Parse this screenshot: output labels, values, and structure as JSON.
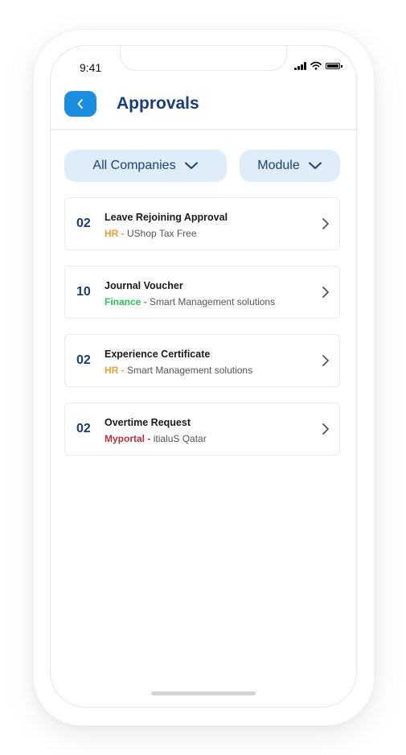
{
  "status": {
    "time": "9:41"
  },
  "header": {
    "title": "Approvals"
  },
  "filters": {
    "companies_label": "All Companies",
    "module_label": "Module"
  },
  "items": [
    {
      "count": "02",
      "title": "Leave Rejoining Approval",
      "module": "HR",
      "module_color": "#f0a030",
      "separator": " - ",
      "company": "UShop Tax Free"
    },
    {
      "count": "10",
      "title": "Journal Voucher",
      "module": "Finance",
      "module_color": "#2fbf5f",
      "separator": " - ",
      "company": "Smart Management solutions"
    },
    {
      "count": "02",
      "title": "Experience Certificate",
      "module": "HR",
      "module_color": "#f0a030",
      "separator": " - ",
      "company": "Smart Management solutions"
    },
    {
      "count": "02",
      "title": "Overtime Request",
      "module": "Myportal",
      "module_color": "#c0303a",
      "separator": " - ",
      "company": "itialuS Qatar"
    }
  ],
  "colors": {
    "accent": "#1a8fe0",
    "title": "#173e7b",
    "filter_bg": "#deedf7"
  }
}
